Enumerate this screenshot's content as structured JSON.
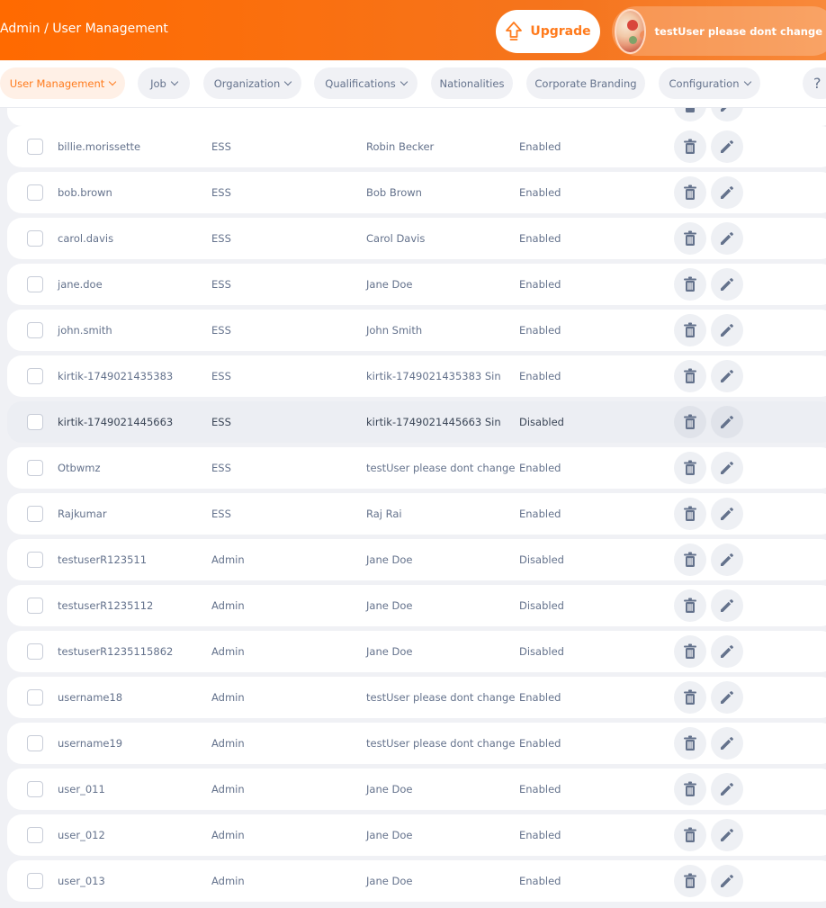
{
  "header": {
    "breadcrumb": "Admin / User Management",
    "upgrade_label": "Upgrade",
    "user_name": "testUser please dont change"
  },
  "nav": {
    "tabs": [
      {
        "label": "User Management",
        "dropdown": true,
        "active": true
      },
      {
        "label": "Job",
        "dropdown": true
      },
      {
        "label": "Organization",
        "dropdown": true
      },
      {
        "label": "Qualifications",
        "dropdown": true
      },
      {
        "label": "Nationalities",
        "dropdown": false
      },
      {
        "label": "Corporate Branding",
        "dropdown": false
      },
      {
        "label": "Configuration",
        "dropdown": true
      }
    ],
    "help_label": "?"
  },
  "colors": {
    "brand_orange": "#ff7b1d",
    "header_gradient_start": "#ff6a00",
    "text_muted": "#64728c",
    "page_bg": "#f0f1f5"
  },
  "icons": {
    "delete": "trash-icon",
    "edit": "pencil-icon",
    "upgrade": "upgrade-arrow-icon"
  },
  "users": [
    {
      "username": "billie.morissette",
      "role": "ESS",
      "employee": "Robin Becker",
      "status": "Enabled"
    },
    {
      "username": "bob.brown",
      "role": "ESS",
      "employee": "Bob Brown",
      "status": "Enabled"
    },
    {
      "username": "carol.davis",
      "role": "ESS",
      "employee": "Carol Davis",
      "status": "Enabled"
    },
    {
      "username": "jane.doe",
      "role": "ESS",
      "employee": "Jane Doe",
      "status": "Enabled"
    },
    {
      "username": "john.smith",
      "role": "ESS",
      "employee": "John Smith",
      "status": "Enabled"
    },
    {
      "username": "kirtik-1749021435383",
      "role": "ESS",
      "employee": "kirtik-1749021435383 Sin",
      "status": "Enabled"
    },
    {
      "username": "kirtik-1749021445663",
      "role": "ESS",
      "employee": "kirtik-1749021445663 Sin",
      "status": "Disabled",
      "highlight": true
    },
    {
      "username": "Otbwmz",
      "role": "ESS",
      "employee": "testUser please dont change",
      "status": "Enabled"
    },
    {
      "username": "Rajkumar",
      "role": "ESS",
      "employee": "Raj Rai",
      "status": "Enabled"
    },
    {
      "username": "testuserR123511",
      "role": "Admin",
      "employee": "Jane Doe",
      "status": "Disabled"
    },
    {
      "username": "testuserR1235112",
      "role": "Admin",
      "employee": "Jane Doe",
      "status": "Disabled"
    },
    {
      "username": "testuserR1235115862",
      "role": "Admin",
      "employee": "Jane Doe",
      "status": "Disabled"
    },
    {
      "username": "username18",
      "role": "Admin",
      "employee": "testUser please dont change",
      "status": "Enabled"
    },
    {
      "username": "username19",
      "role": "Admin",
      "employee": "testUser please dont change",
      "status": "Enabled"
    },
    {
      "username": "user_011",
      "role": "Admin",
      "employee": "Jane Doe",
      "status": "Enabled"
    },
    {
      "username": "user_012",
      "role": "Admin",
      "employee": "Jane Doe",
      "status": "Enabled"
    },
    {
      "username": "user_013",
      "role": "Admin",
      "employee": "Jane Doe",
      "status": "Enabled"
    }
  ]
}
